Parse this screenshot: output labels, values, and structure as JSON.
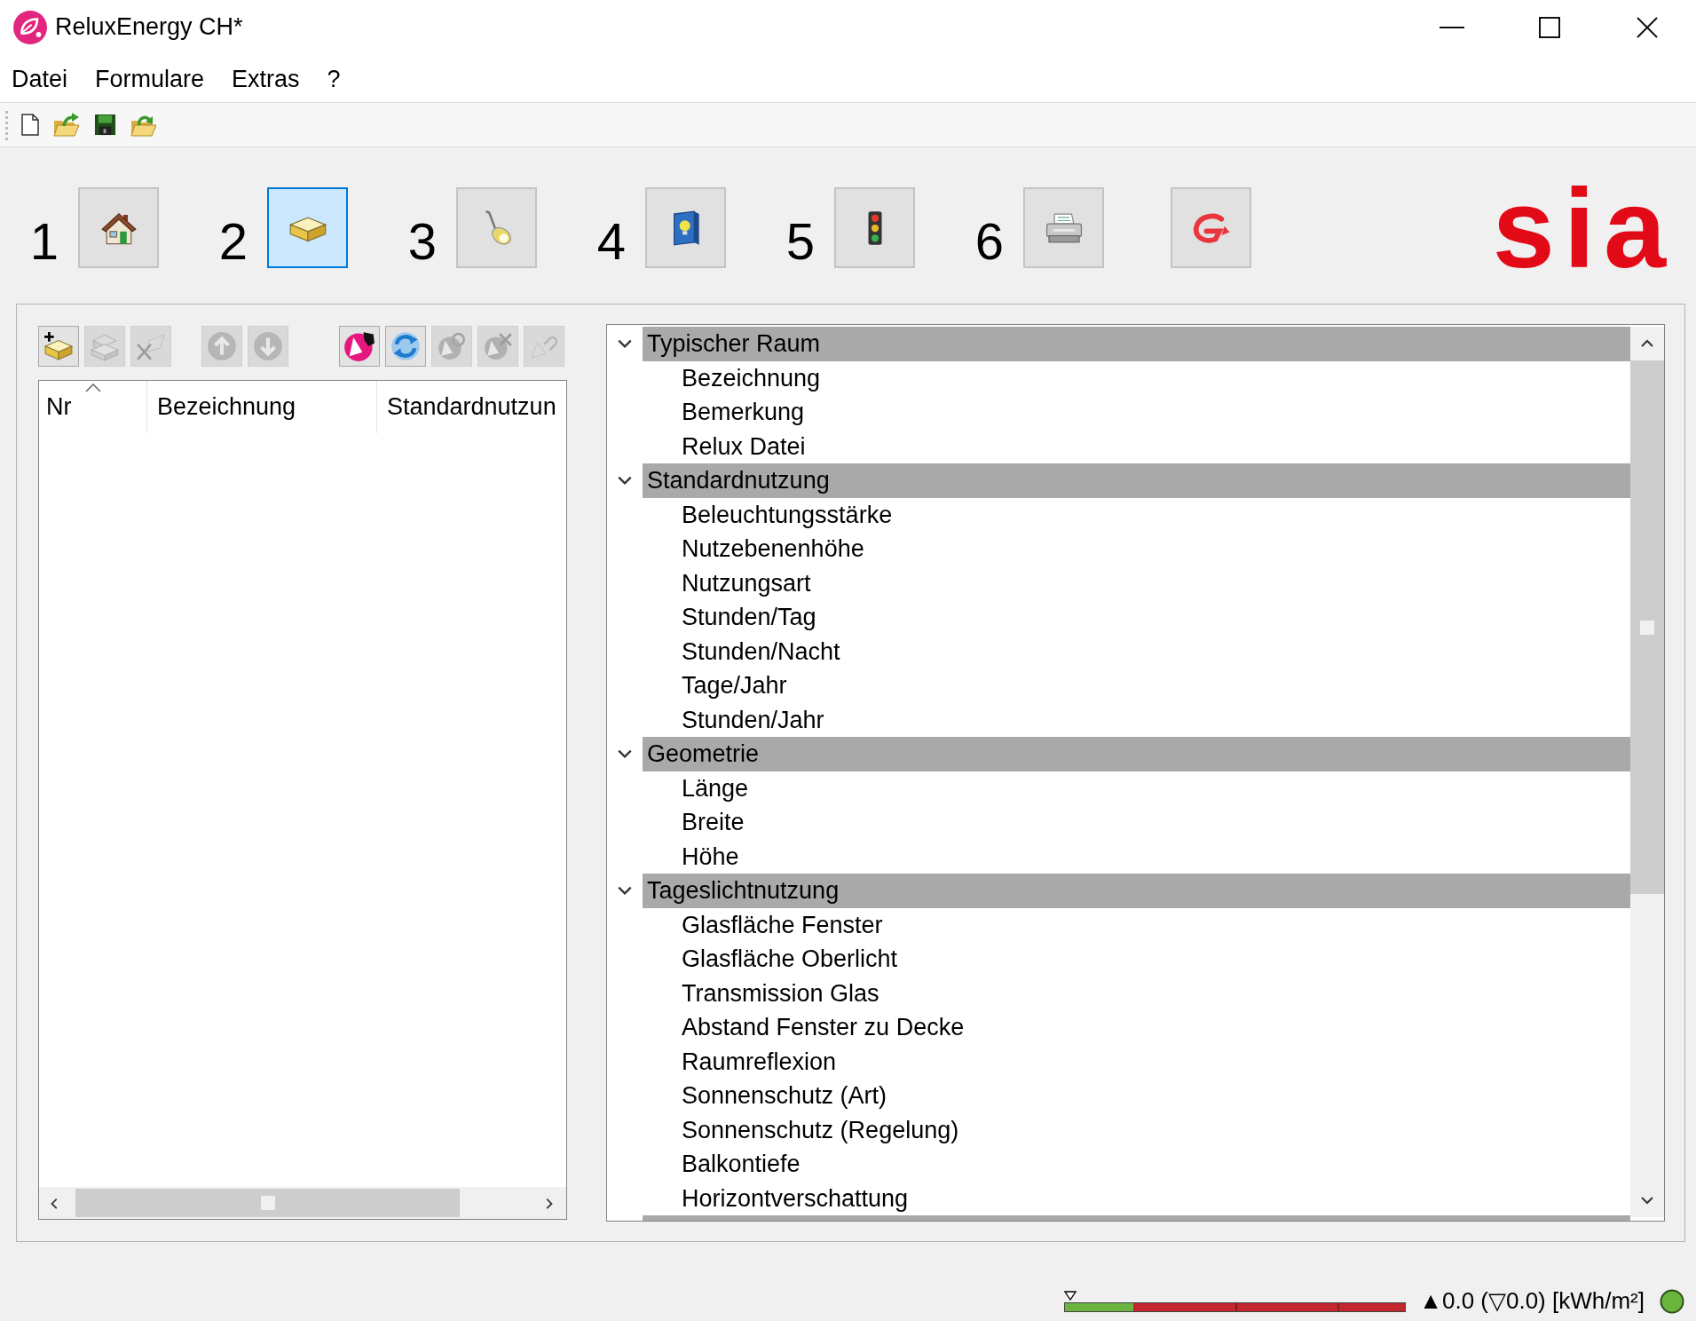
{
  "window": {
    "title": "ReluxEnergy CH*"
  },
  "menu": [
    "Datei",
    "Formulare",
    "Extras",
    "?"
  ],
  "steps": [
    {
      "number": "1",
      "selected": false
    },
    {
      "number": "2",
      "selected": true
    },
    {
      "number": "3",
      "selected": false
    },
    {
      "number": "4",
      "selected": false
    },
    {
      "number": "5",
      "selected": false
    },
    {
      "number": "6",
      "selected": false
    }
  ],
  "logo": {
    "text": "sia"
  },
  "list_toolbar": {
    "groups": [
      {
        "buttons": [
          {
            "disabled": false
          },
          {
            "disabled": true
          },
          {
            "disabled": true
          }
        ]
      },
      {
        "buttons": [
          {
            "disabled": true
          },
          {
            "disabled": true
          }
        ]
      },
      {
        "buttons": [
          {
            "disabled": false
          },
          {
            "disabled": false
          },
          {
            "disabled": true
          },
          {
            "disabled": true
          },
          {
            "disabled": true
          }
        ]
      }
    ]
  },
  "table": {
    "columns": [
      {
        "label": "Nr",
        "sorted": true
      },
      {
        "label": "Bezeichnung",
        "sorted": false
      },
      {
        "label": "Standardnutzun",
        "sorted": false
      }
    ]
  },
  "tree": {
    "groups": [
      {
        "label": "Typischer Raum",
        "expanded": true,
        "children": [
          {
            "label": "Bezeichnung"
          },
          {
            "label": "Bemerkung"
          },
          {
            "label": "Relux Datei"
          }
        ]
      },
      {
        "label": "Standardnutzung",
        "expanded": true,
        "children": [
          {
            "label": "Beleuchtungsstärke"
          },
          {
            "label": "Nutzebenenhöhe"
          },
          {
            "label": "Nutzungsart"
          },
          {
            "label": "Stunden/Tag"
          },
          {
            "label": "Stunden/Nacht"
          },
          {
            "label": "Tage/Jahr"
          },
          {
            "label": "Stunden/Jahr"
          }
        ]
      },
      {
        "label": "Geometrie",
        "expanded": true,
        "children": [
          {
            "label": "Länge"
          },
          {
            "label": "Breite"
          },
          {
            "label": "Höhe"
          }
        ]
      },
      {
        "label": "Tageslichtnutzung",
        "expanded": true,
        "children": [
          {
            "label": "Glasfläche Fenster"
          },
          {
            "label": "Glasfläche Oberlicht"
          },
          {
            "label": "Transmission Glas"
          },
          {
            "label": "Abstand Fenster zu Decke"
          },
          {
            "label": "Raumreflexion"
          },
          {
            "label": "Sonnenschutz (Art)"
          },
          {
            "label": "Sonnenschutz (Regelung)"
          },
          {
            "label": "Balkontiefe"
          },
          {
            "label": "Horizontverschattung"
          }
        ]
      }
    ]
  },
  "status_bar": {
    "meter": {
      "level": 0.2
    },
    "reading": "▲0.0 (▽0.0) [kWh/m²]",
    "indicator": {
      "color": "#6ab43e"
    }
  }
}
